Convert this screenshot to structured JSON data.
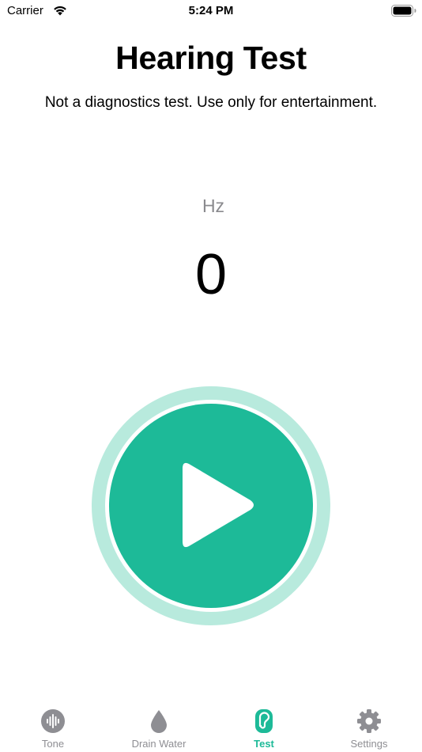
{
  "status_bar": {
    "carrier": "Carrier",
    "time": "5:24 PM"
  },
  "header": {
    "title": "Hearing Test",
    "subtitle": "Not a diagnostics test. Use only for entertainment."
  },
  "frequency": {
    "unit": "Hz",
    "value": "0"
  },
  "play_button": {
    "icon": "play-icon"
  },
  "tab_bar": {
    "tabs": [
      {
        "label": "Tone",
        "icon": "waveform-icon",
        "active": false
      },
      {
        "label": "Drain Water",
        "icon": "drop-icon",
        "active": false
      },
      {
        "label": "Test",
        "icon": "ear-icon",
        "active": true
      },
      {
        "label": "Settings",
        "icon": "gear-icon",
        "active": false
      }
    ]
  },
  "colors": {
    "accent": "#1dba98",
    "accent_light": "#b8eadd",
    "inactive": "#8e8e93"
  }
}
